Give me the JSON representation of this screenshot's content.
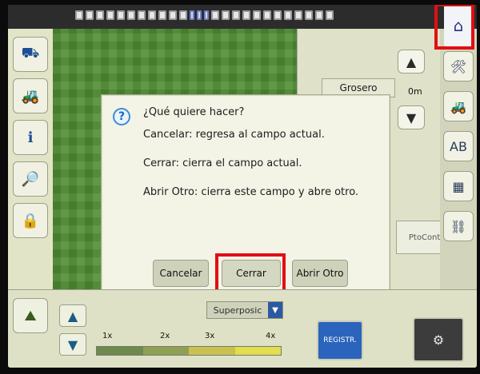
{
  "dialog": {
    "title": "¿Qué quiere hacer?",
    "lines": [
      "Cancelar: regresa al campo actual.",
      "Cerrar: cierra el campo actual.",
      "Abrir Otro: cierra este campo y abre otro."
    ],
    "buttons": {
      "cancel": "Cancelar",
      "close": "Cerrar",
      "open_other": "Abrir Otro"
    }
  },
  "right_panel": {
    "grosero_label": "Grosero",
    "distance": "0m",
    "pto_control": "PtoControl"
  },
  "bottom": {
    "overlay_select_value": "Superposic",
    "scale_labels": [
      "1x",
      "2x",
      "3x",
      "4x"
    ],
    "record_label": "REGISTR."
  },
  "icons": {
    "top_home": "home-icon",
    "compass": "compass-icon"
  },
  "colors": {
    "highlight_red": "#e10f14",
    "map_green": "#4f8d33",
    "accent_blue": "#2b5aa0"
  }
}
